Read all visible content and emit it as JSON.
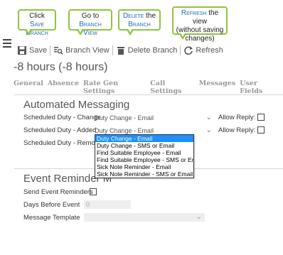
{
  "callouts": {
    "save": {
      "line1": "Click",
      "line1b": "Save",
      "line2": "Branch"
    },
    "view": {
      "line1": "Go to",
      "line2": "Branch View"
    },
    "delete": {
      "line1a": "Delete",
      "line1b": "the",
      "line2": "Branch"
    },
    "refresh": {
      "line1a": "Refresh",
      "line1b": "the view",
      "line2": "(without saving",
      "line3": "changes)"
    }
  },
  "toolbar": {
    "save_label": "Save",
    "view_label": "Branch View",
    "delete_label": "Delete Branch",
    "refresh_label": "Refresh"
  },
  "page_title": "-8 hours (-8 hours)",
  "tabs": [
    "General",
    "Absence",
    "Rate Gen Settings",
    "Call Settings",
    "Messages",
    "User Fields"
  ],
  "automated": {
    "title": "Automated Messaging",
    "rows": [
      {
        "label": "Scheduled Duty - Change",
        "value": "Duty Change - Email",
        "allow": "Allow Reply:"
      },
      {
        "label": "Scheduled Duty - Added",
        "value": "Duty Change - Email",
        "allow": "Allow Reply:"
      },
      {
        "label": "Scheduled Duty - Remove",
        "value": "",
        "allow": ""
      }
    ]
  },
  "dropdown": {
    "options": [
      "Duty Change - Email",
      "Duty Change - SMS or Email",
      "Find Suitable Employee - Email",
      "Find Suitable Employee - SMS or Email",
      "Sick Note Reminder - Email",
      "Sick Note Reminder - SMS or Email"
    ],
    "selected_index": 0
  },
  "event": {
    "title": "Event Reminder M",
    "send_label": "Send Event Reminders",
    "days_label": "Days Before Event",
    "days_value": "0",
    "template_label": "Message Template",
    "template_value": ""
  },
  "colors": {
    "callout_border": "#8dc63f",
    "smallcaps": "#1f6fb5",
    "selected": "#1e90ff"
  }
}
